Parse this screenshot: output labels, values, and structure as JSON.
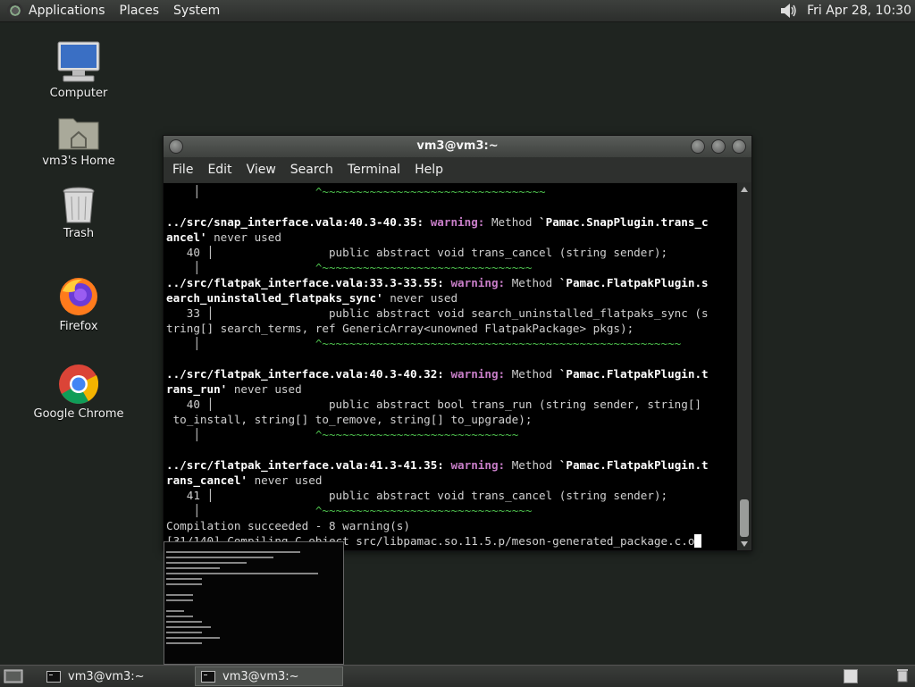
{
  "top_panel": {
    "menus": [
      "Applications",
      "Places",
      "System"
    ],
    "clock": "Fri Apr 28, 10:30"
  },
  "desktop_icons": [
    {
      "label": "Computer",
      "icon": "computer-icon"
    },
    {
      "label": "vm3's Home",
      "icon": "home-folder-icon"
    },
    {
      "label": "Trash",
      "icon": "trash-icon"
    },
    {
      "label": "Firefox",
      "icon": "firefox-icon"
    },
    {
      "label": "Google Chrome",
      "icon": "chrome-icon"
    }
  ],
  "window": {
    "title": "vm3@vm3:~",
    "menu": [
      "File",
      "Edit",
      "View",
      "Search",
      "Terminal",
      "Help"
    ]
  },
  "terminal": {
    "lines": [
      {
        "segs": [
          {
            "t": "    │                 ",
            "c": ""
          },
          {
            "t": "^~~~~~~~~~~~~~~~~~~~~~~~~~~~~~~~~~",
            "c": "g"
          }
        ]
      },
      {
        "segs": []
      },
      {
        "segs": [
          {
            "t": "../src/snap_interface.vala:40.3-40.35:",
            "c": "b"
          },
          {
            "t": " ",
            "c": ""
          },
          {
            "t": "warning:",
            "c": "w"
          },
          {
            "t": " Method ",
            "c": ""
          },
          {
            "t": "`Pamac.SnapPlugin.trans_c",
            "c": "b"
          }
        ]
      },
      {
        "segs": [
          {
            "t": "ancel'",
            "c": "b"
          },
          {
            "t": " never used",
            "c": ""
          }
        ]
      },
      {
        "segs": [
          {
            "t": "   40 │                 public abstract void trans_cancel (string sender);",
            "c": ""
          }
        ]
      },
      {
        "segs": [
          {
            "t": "    │                 ",
            "c": ""
          },
          {
            "t": "^~~~~~~~~~~~~~~~~~~~~~~~~~~~~~~~",
            "c": "g"
          }
        ]
      },
      {
        "segs": [
          {
            "t": "../src/flatpak_interface.vala:33.3-33.55:",
            "c": "b"
          },
          {
            "t": " ",
            "c": ""
          },
          {
            "t": "warning:",
            "c": "w"
          },
          {
            "t": " Method ",
            "c": ""
          },
          {
            "t": "`Pamac.FlatpakPlugin.s",
            "c": "b"
          }
        ]
      },
      {
        "segs": [
          {
            "t": "earch_uninstalled_flatpaks_sync'",
            "c": "b"
          },
          {
            "t": " never used",
            "c": ""
          }
        ]
      },
      {
        "segs": [
          {
            "t": "   33 │                 public abstract void search_uninstalled_flatpaks_sync (s",
            "c": ""
          }
        ]
      },
      {
        "segs": [
          {
            "t": "tring[] search_terms, ref GenericArray<unowned FlatpakPackage> pkgs);",
            "c": ""
          }
        ]
      },
      {
        "segs": [
          {
            "t": "    │                 ",
            "c": ""
          },
          {
            "t": "^~~~~~~~~~~~~~~~~~~~~~~~~~~~~~~~~~~~~~~~~~~~~~~~~~~~~~",
            "c": "g"
          }
        ]
      },
      {
        "segs": []
      },
      {
        "segs": [
          {
            "t": "../src/flatpak_interface.vala:40.3-40.32:",
            "c": "b"
          },
          {
            "t": " ",
            "c": ""
          },
          {
            "t": "warning:",
            "c": "w"
          },
          {
            "t": " Method ",
            "c": ""
          },
          {
            "t": "`Pamac.FlatpakPlugin.t",
            "c": "b"
          }
        ]
      },
      {
        "segs": [
          {
            "t": "rans_run'",
            "c": "b"
          },
          {
            "t": " never used",
            "c": ""
          }
        ]
      },
      {
        "segs": [
          {
            "t": "   40 │                 public abstract bool trans_run (string sender, string[]",
            "c": ""
          }
        ]
      },
      {
        "segs": [
          {
            "t": " to_install, string[] to_remove, string[] to_upgrade);",
            "c": ""
          }
        ]
      },
      {
        "segs": [
          {
            "t": "    │                 ",
            "c": ""
          },
          {
            "t": "^~~~~~~~~~~~~~~~~~~~~~~~~~~~~~",
            "c": "g"
          }
        ]
      },
      {
        "segs": []
      },
      {
        "segs": [
          {
            "t": "../src/flatpak_interface.vala:41.3-41.35:",
            "c": "b"
          },
          {
            "t": " ",
            "c": ""
          },
          {
            "t": "warning:",
            "c": "w"
          },
          {
            "t": " Method ",
            "c": ""
          },
          {
            "t": "`Pamac.FlatpakPlugin.t",
            "c": "b"
          }
        ]
      },
      {
        "segs": [
          {
            "t": "rans_cancel'",
            "c": "b"
          },
          {
            "t": " never used",
            "c": ""
          }
        ]
      },
      {
        "segs": [
          {
            "t": "   41 │                 public abstract void trans_cancel (string sender);",
            "c": ""
          }
        ]
      },
      {
        "segs": [
          {
            "t": "    │                 ",
            "c": ""
          },
          {
            "t": "^~~~~~~~~~~~~~~~~~~~~~~~~~~~~~~~",
            "c": "g"
          }
        ]
      },
      {
        "segs": [
          {
            "t": "Compilation succeeded - 8 warning(s)",
            "c": ""
          }
        ]
      },
      {
        "segs": [
          {
            "t": "[31/140] Compiling C object src/libpamac.so.11.5.p/meson-generated_package.c.o",
            "c": ""
          }
        ]
      }
    ]
  },
  "taskbar": {
    "tasks": [
      {
        "label": "vm3@vm3:~",
        "active": false
      },
      {
        "label": "vm3@vm3:~",
        "active": true
      }
    ]
  }
}
